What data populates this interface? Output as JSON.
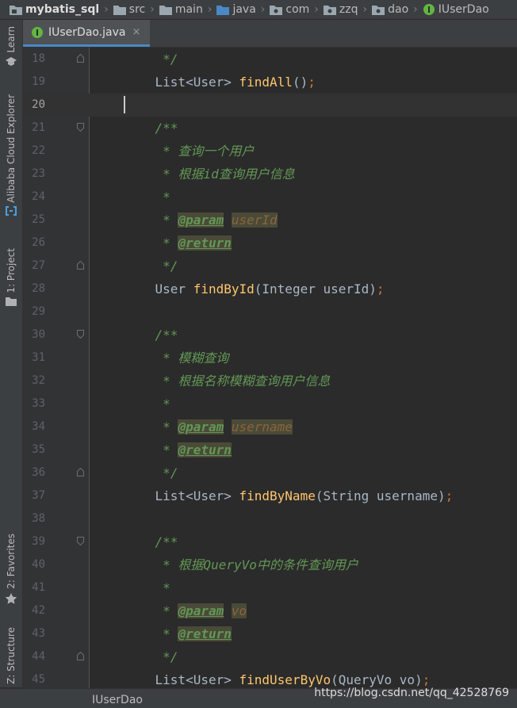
{
  "breadcrumb": [
    "mybatis_sql",
    "src",
    "main",
    "java",
    "com",
    "zzq",
    "dao",
    "IUserDao"
  ],
  "left_tools": [
    "Learn",
    "Alibaba Cloud Explorer",
    "1: Project",
    "2: Favorites",
    "Z: Structure"
  ],
  "tab": {
    "label": "IUserDao.java",
    "close": "×"
  },
  "lines": [
    {
      "num": "18",
      "code": "     */"
    },
    {
      "num": "19",
      "code": "    List<User> findAll();"
    },
    {
      "num": "20",
      "code": ""
    },
    {
      "num": "21",
      "code": "    /**"
    },
    {
      "num": "22",
      "code": "     * 查询一个用户"
    },
    {
      "num": "23",
      "code": "     * 根据id查询用户信息"
    },
    {
      "num": "24",
      "code": "     *"
    },
    {
      "num": "25",
      "code": "     * @param userId"
    },
    {
      "num": "26",
      "code": "     * @return"
    },
    {
      "num": "27",
      "code": "     */"
    },
    {
      "num": "28",
      "code": "    User findById(Integer userId);"
    },
    {
      "num": "29",
      "code": ""
    },
    {
      "num": "30",
      "code": "    /**"
    },
    {
      "num": "31",
      "code": "     * 模糊查询"
    },
    {
      "num": "32",
      "code": "     * 根据名称模糊查询用户信息"
    },
    {
      "num": "33",
      "code": "     *"
    },
    {
      "num": "34",
      "code": "     * @param username"
    },
    {
      "num": "35",
      "code": "     * @return"
    },
    {
      "num": "36",
      "code": "     */"
    },
    {
      "num": "37",
      "code": "    List<User> findByName(String username);"
    },
    {
      "num": "38",
      "code": ""
    },
    {
      "num": "39",
      "code": "    /**"
    },
    {
      "num": "40",
      "code": "     * 根据QueryVo中的条件查询用户"
    },
    {
      "num": "41",
      "code": "     *"
    },
    {
      "num": "42",
      "code": "     * @param vo"
    },
    {
      "num": "43",
      "code": "     * @return"
    },
    {
      "num": "44",
      "code": "     */"
    },
    {
      "num": "45",
      "code": "    List<User> findUserByVo(QueryVo vo);"
    }
  ],
  "status": {
    "left": "IUserDao",
    "watermark": "https://blog.csdn.net/qq_42528769"
  }
}
